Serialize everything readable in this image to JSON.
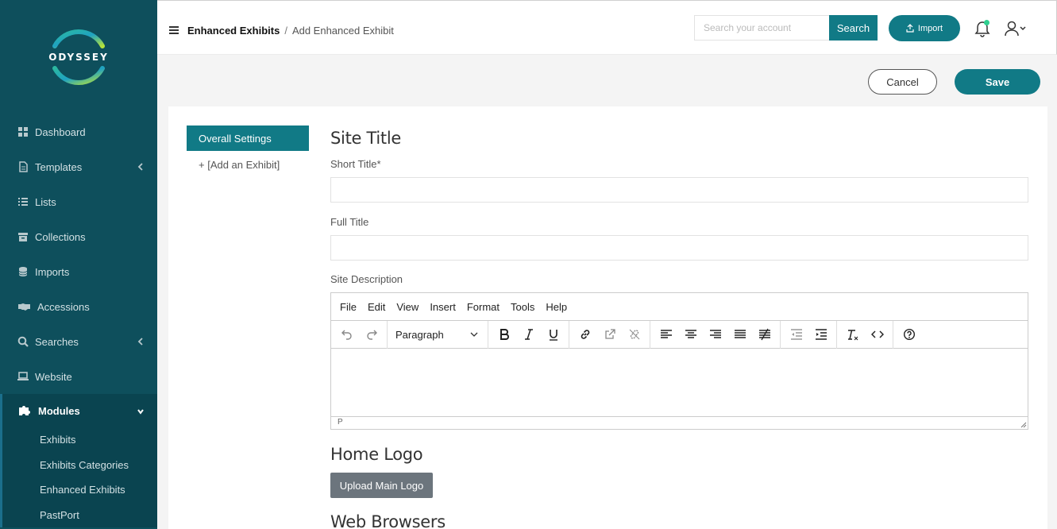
{
  "brand": {
    "name": "ODYSSEY"
  },
  "sidebar": {
    "items": [
      {
        "label": "Dashboard",
        "icon": "dashboard-icon"
      },
      {
        "label": "Templates",
        "icon": "file-icon",
        "expandable": true
      },
      {
        "label": "Lists",
        "icon": "list-icon"
      },
      {
        "label": "Collections",
        "icon": "archive-icon"
      },
      {
        "label": "Imports",
        "icon": "database-icon"
      },
      {
        "label": "Accessions",
        "icon": "handshake-icon"
      },
      {
        "label": "Searches",
        "icon": "search-icon",
        "expandable": true
      },
      {
        "label": "Website",
        "icon": "laptop-icon"
      },
      {
        "label": "Modules",
        "icon": "puzzle-icon",
        "expanded": true
      }
    ],
    "submodules": [
      {
        "label": "Exhibits"
      },
      {
        "label": "Exhibits Categories"
      },
      {
        "label": "Enhanced Exhibits"
      },
      {
        "label": "PastPort"
      }
    ]
  },
  "header": {
    "breadcrumb_current": "Enhanced Exhibits",
    "breadcrumb_separator": "/",
    "breadcrumb_page": "Add Enhanced Exhibit",
    "search_placeholder": "Search your account",
    "search_label": "Search",
    "import_label": "Import",
    "notification_unread": true
  },
  "actions": {
    "cancel_label": "Cancel",
    "save_label": "Save"
  },
  "tabs": {
    "active": "Overall Settings",
    "add": "+ [Add an Exhibit]"
  },
  "form": {
    "site_title_heading": "Site Title",
    "short_title_label": "Short Title*",
    "short_title_value": "",
    "full_title_label": "Full Title",
    "full_title_value": "",
    "site_description_label": "Site Description",
    "home_logo_heading": "Home Logo",
    "upload_logo_label": "Upload Main Logo",
    "web_browsers_heading": "Web Browsers"
  },
  "editor": {
    "menus": [
      "File",
      "Edit",
      "View",
      "Insert",
      "Format",
      "Tools",
      "Help"
    ],
    "block_format": "Paragraph",
    "status_path": "P"
  },
  "colors": {
    "sidebar_bg": "#0e4f5c",
    "accent": "#117a86",
    "secondary_button": "#6c757d"
  }
}
